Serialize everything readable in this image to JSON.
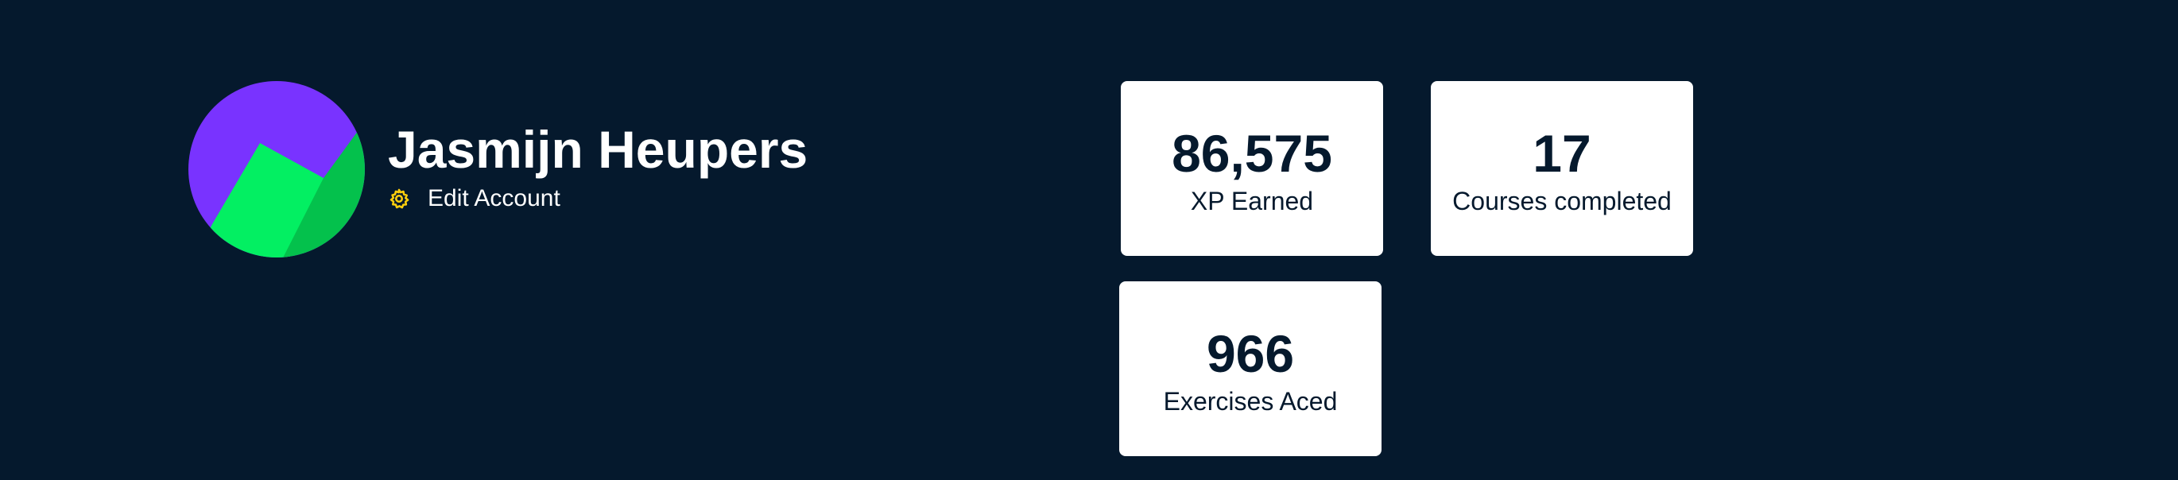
{
  "profile": {
    "name": "Jasmijn Heupers",
    "edit_account_label": "Edit Account",
    "avatar_icon": "avatar-geometric-icon",
    "edit_icon": "gear-icon"
  },
  "stats": {
    "xp": {
      "value": "86,575",
      "label": "XP Earned"
    },
    "courses": {
      "value": "17",
      "label": "Courses completed"
    },
    "exercises": {
      "value": "966",
      "label": "Exercises Aced"
    }
  },
  "colors": {
    "background": "#05192d",
    "card": "#ffffff",
    "text_dark": "#05192d",
    "accent_yellow": "#fcce0d",
    "avatar_purple": "#7933ff",
    "avatar_green": "#03ef62",
    "avatar_dark_green": "#04c14c"
  }
}
